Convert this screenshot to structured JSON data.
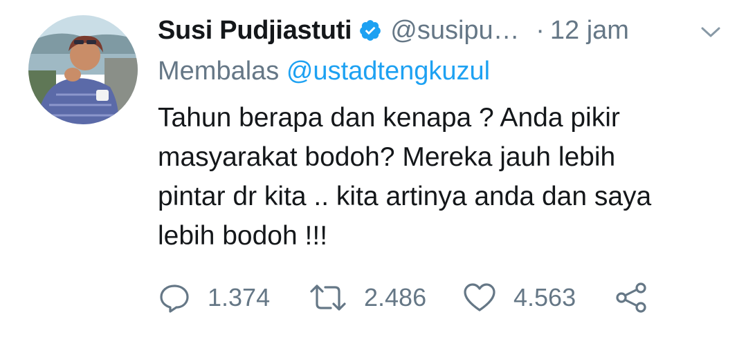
{
  "tweet": {
    "author_name": "Susi Pudjiastuti",
    "handle": "@susipudjiastuti",
    "separator": "·",
    "time": "12 jam",
    "reply_prefix": "Membalas",
    "reply_to": "@ustadtengkuzul",
    "body_lines": [
      "Tahun berapa dan kenapa ? Anda pikir",
      "masyarakat bodoh? Mereka jauh lebih",
      "pintar dr kita .. kita artinya anda dan saya",
      "lebih bodoh !!!"
    ]
  },
  "actions": {
    "reply_count": "1.374",
    "retweet_count": "2.486",
    "like_count": "4.563"
  },
  "icons": {
    "verified": "verified-badge-icon",
    "caret": "chevron-down-icon",
    "reply": "reply-icon",
    "retweet": "retweet-icon",
    "like": "heart-icon",
    "share": "share-icon"
  },
  "colors": {
    "text": "#14171a",
    "secondary": "#657786",
    "accent": "#1da1f2"
  }
}
